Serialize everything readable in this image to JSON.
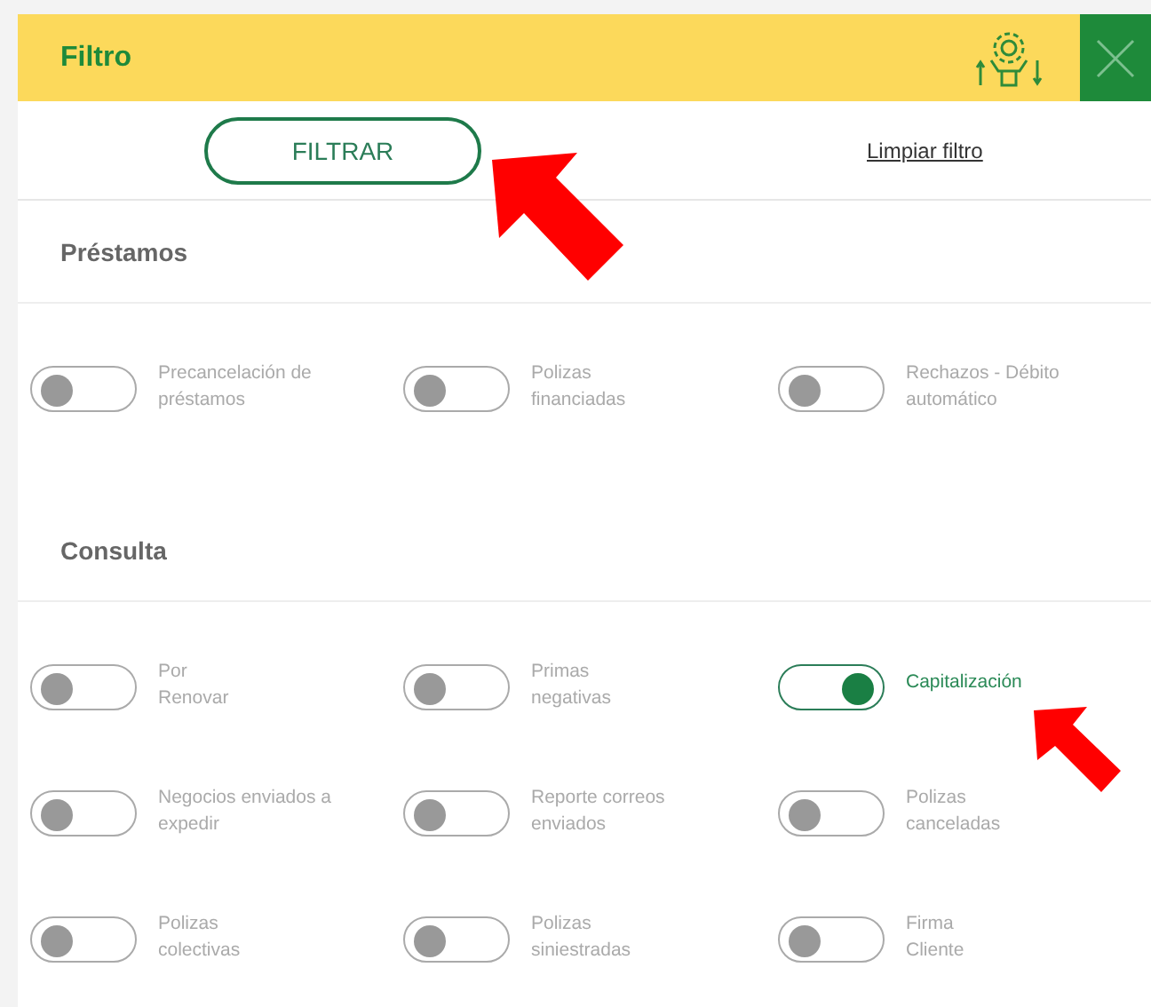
{
  "header": {
    "title": "Filtro"
  },
  "actions": {
    "filter_button": "FILTRAR",
    "clear_link": "Limpiar filtro"
  },
  "sections": [
    {
      "title": "Préstamos",
      "options": [
        {
          "label": "Precancelación de\npréstamos",
          "on": false
        },
        {
          "label": "Polizas\nfinanciadas",
          "on": false
        },
        {
          "label": "Rechazos - Débito\nautomático",
          "on": false
        }
      ]
    },
    {
      "title": "Consulta",
      "options": [
        {
          "label": "Por\nRenovar",
          "on": false
        },
        {
          "label": "Primas\nnegativas",
          "on": false
        },
        {
          "label": "Capitalización",
          "on": true
        },
        {
          "label": "Negocios enviados a\nexpedir",
          "on": false
        },
        {
          "label": "Reporte correos\nenviados",
          "on": false
        },
        {
          "label": "Polizas\ncanceladas",
          "on": false
        },
        {
          "label": "Polizas\ncolectivas",
          "on": false
        },
        {
          "label": "Polizas\nsiniestradas",
          "on": false
        },
        {
          "label": "Firma\nCliente",
          "on": false
        }
      ]
    }
  ]
}
